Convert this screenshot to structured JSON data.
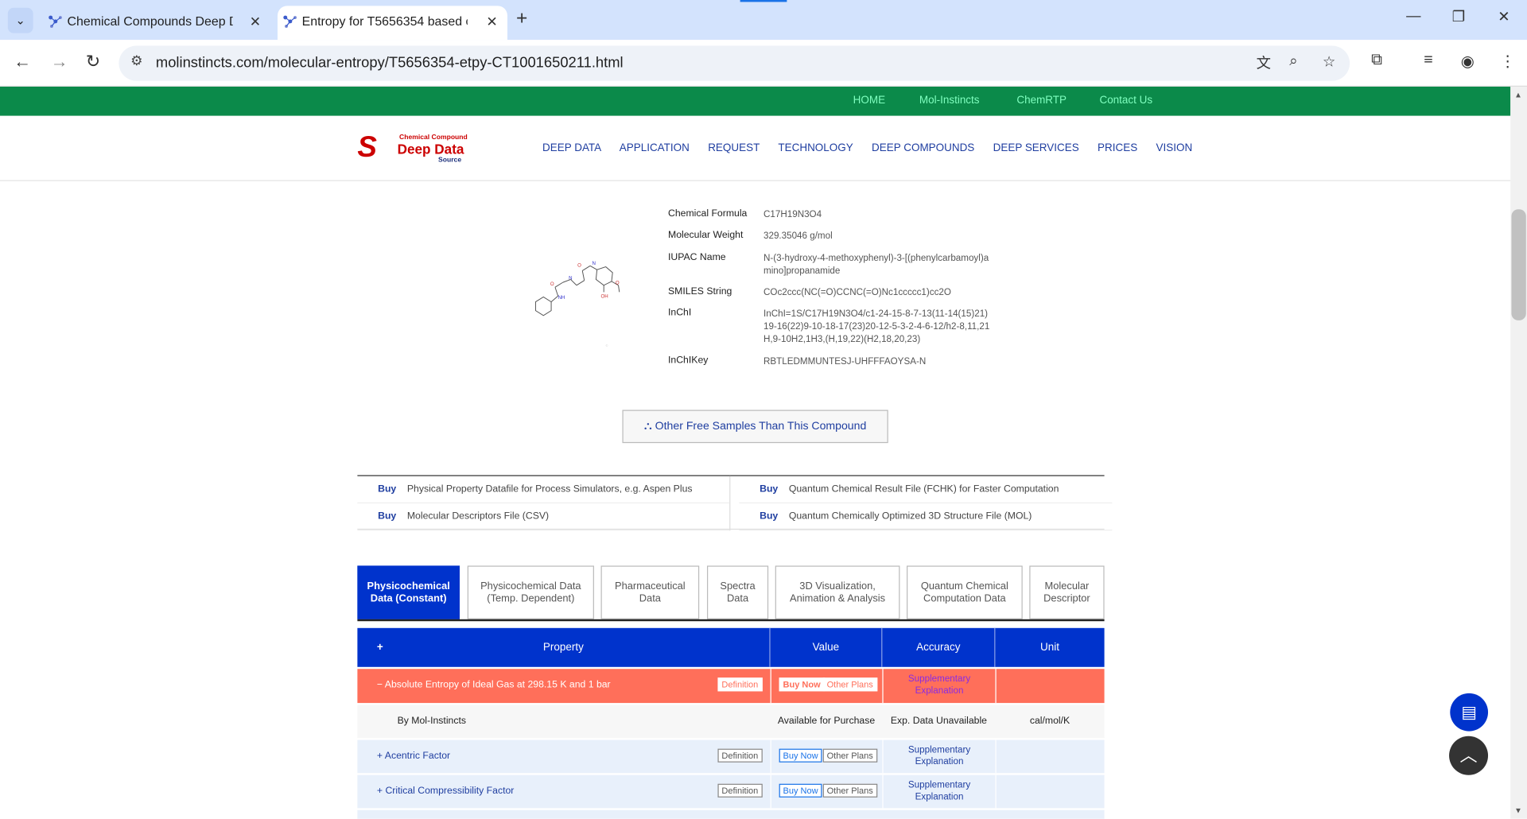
{
  "browser": {
    "tabs": [
      {
        "title": "Chemical Compounds Deep D"
      },
      {
        "title": "Entropy for T5656354 based o"
      }
    ],
    "url": "molinstincts.com/molecular-entropy/T5656354-etpy-CT1001650211.html",
    "icons": [
      "back-icon",
      "forward-icon",
      "reload-icon",
      "site-settings-icon",
      "translate-icon",
      "zoom-icon",
      "star-icon",
      "extensions-icon",
      "media-icon",
      "profile-icon",
      "menu-icon"
    ]
  },
  "topnav": [
    "HOME",
    "Mol-Instincts",
    "ChemRTP",
    "Contact Us"
  ],
  "logo": {
    "line1": "Chemical  Compound",
    "line2": "Deep Data",
    "line3": "Source"
  },
  "mainnav": [
    "DEEP DATA",
    "APPLICATION",
    "REQUEST",
    "TECHNOLOGY",
    "DEEP COMPOUNDS",
    "DEEP SERVICES",
    "PRICES",
    "VISION"
  ],
  "compound": {
    "formula_label": "Chemical Formula",
    "formula": "C17H19N3O4",
    "mw_label": "Molecular Weight",
    "mw": "329.35046 g/mol",
    "iupac_label": "IUPAC Name",
    "iupac": "N-(3-hydroxy-4-methoxyphenyl)-3-[(phenylcarbamoyl)amino]propanamide",
    "smiles_label": "SMILES String",
    "smiles": "COc2ccc(NC(=O)CCNC(=O)Nc1ccccc1)cc2O",
    "inchi_label": "InChI",
    "inchi": "InChI=1S/C17H19N3O4/c1-24-15-8-7-13(11-14(15)21)19-16(22)9-10-18-17(23)20-12-5-3-2-4-6-12/h2-8,11,21H,9-10H2,1H3,(H,19,22)(H2,18,20,23)",
    "inchikey_label": "InChIKey",
    "inchikey": "RBTLEDMMUNTESJ-UHFFFAOYSA-N"
  },
  "samples_button": "Other Free Samples Than This Compound",
  "buy": {
    "left": [
      {
        "label": "Buy",
        "text": "Physical Property Datafile for Process Simulators, e.g. Aspen Plus"
      },
      {
        "label": "Buy",
        "text": "Molecular Descriptors File (CSV)"
      }
    ],
    "right": [
      {
        "label": "Buy",
        "text": "Quantum Chemical Result File (FCHK) for Faster Computation"
      },
      {
        "label": "Buy",
        "text": "Quantum Chemically Optimized 3D Structure File (MOL)"
      }
    ]
  },
  "datatabs": [
    {
      "l1": "Physicochemical",
      "l2": "Data (Constant)"
    },
    {
      "l1": "Physicochemical Data",
      "l2": "(Temp. Dependent)"
    },
    {
      "l1": "Pharmaceutical",
      "l2": "Data"
    },
    {
      "l1": "Spectra",
      "l2": "Data"
    },
    {
      "l1": "3D Visualization,",
      "l2": "Animation & Analysis"
    },
    {
      "l1": "Quantum Chemical",
      "l2": "Computation Data"
    },
    {
      "l1": "Molecular",
      "l2": "Descriptor"
    }
  ],
  "table": {
    "headers": {
      "plus": "+",
      "property": "Property",
      "value": "Value",
      "accuracy": "Accuracy",
      "unit": "Unit"
    },
    "expanded": {
      "sign": "−",
      "name": "Absolute Entropy of Ideal Gas at 298.15 K and 1 bar",
      "definition": "Definition",
      "buy_now": "Buy Now",
      "other_plans": "Other Plans",
      "supp1": "Supplementary",
      "supp2": "Explanation"
    },
    "detail": {
      "source": "By Mol-Instincts",
      "value": "Available for Purchase",
      "accuracy": "Exp. Data Unavailable",
      "unit": "cal/mol/K"
    },
    "rows": [
      {
        "sign": "+",
        "name": "Acentric Factor",
        "definition": "Definition",
        "buy_now": "Buy Now",
        "other_plans": "Other Plans",
        "supp1": "Supplementary",
        "supp2": "Explanation"
      },
      {
        "sign": "+",
        "name": "Critical Compressibility Factor",
        "definition": "Definition",
        "buy_now": "Buy Now",
        "other_plans": "Other Plans",
        "supp1": "Supplementary",
        "supp2": "Explanation"
      }
    ]
  }
}
